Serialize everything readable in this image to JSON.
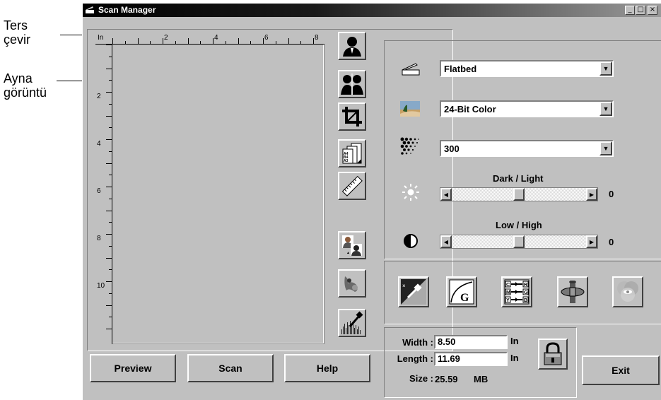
{
  "callouts": {
    "flip": "Ters\nçevir",
    "mirror": "Ayna\ngörüntü"
  },
  "window": {
    "title": "Scan Manager",
    "controls": {
      "minimize": "_",
      "maximize": "□",
      "close": "×"
    }
  },
  "preview": {
    "ruler_unit": "In",
    "top_labels": [
      "2",
      "4",
      "6",
      "8"
    ],
    "left_labels": [
      "2",
      "4",
      "6",
      "8",
      "10"
    ]
  },
  "tools": [
    {
      "name": "flip-icon"
    },
    {
      "name": "mirror-icon"
    },
    {
      "name": "crop-icon"
    },
    {
      "name": "paper-size-icon"
    },
    {
      "name": "ruler-icon"
    },
    {
      "name": "multi-image-icon"
    },
    {
      "name": "descreen-icon"
    },
    {
      "name": "histogram-icon"
    }
  ],
  "settings": {
    "source": "Flatbed",
    "image_type": "24-Bit Color",
    "resolution": "300",
    "brightness_label": "Dark / Light",
    "brightness_value": "0",
    "brightness_level": 0.5,
    "contrast_label": "Low / High",
    "contrast_value": "0",
    "contrast_level": 0.5
  },
  "adjust_tools": [
    {
      "name": "color-picker-icon"
    },
    {
      "name": "gamma-curve-icon"
    },
    {
      "name": "color-balance-icon"
    },
    {
      "name": "filter-icon"
    },
    {
      "name": "color-match-icon"
    }
  ],
  "size": {
    "width_label": "Width :",
    "width_value": "8.50",
    "length_label": "Length :",
    "length_value": "11.69",
    "unit": "In",
    "size_label": "Size :",
    "size_value": "25.59",
    "size_unit": "MB"
  },
  "buttons": {
    "preview": "Preview",
    "scan": "Scan",
    "help": "Help",
    "exit": "Exit"
  }
}
